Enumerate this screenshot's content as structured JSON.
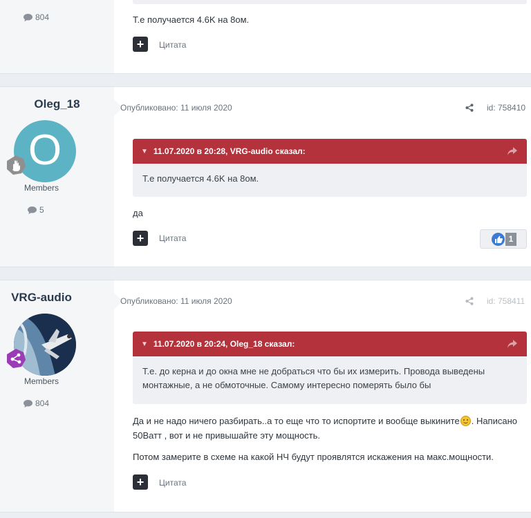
{
  "posts": [
    {
      "count": "804",
      "text": [
        "Т.е получается 4.6K на 8ом."
      ],
      "quote_label": "Цитата"
    },
    {
      "author": "Oleg_18",
      "avatar_letter": "O",
      "role": "Members",
      "count": "5",
      "published": "Опубликовано: 11 июля 2020",
      "post_id": "id: 758410",
      "quote_header": "11.07.2020 в 20:28, VRG-audio сказал:",
      "quote_text": "Т.е получается 4.6K на 8ом.",
      "text": [
        "да"
      ],
      "quote_label": "Цитата",
      "reaction_count": "1"
    },
    {
      "author": "VRG-audio",
      "role": "Members",
      "count": "804",
      "published": "Опубликовано: 11 июля 2020",
      "post_id": "id: 758411",
      "quote_header": "11.07.2020 в 20:24, Oleg_18 сказал:",
      "quote_text": "Т.е. до керна и до окна мне не добраться что бы их измерить. Провода выведены монтажные, а не обмоточные. Самому интересно померять было бы",
      "text": [
        "Да и не надо ничего разбирать..а то еще что то испортите и вообще выкините",
        ". Написано 50Ватт , вот и не привышайте эту мощность.",
        "Потом замерите в схеме на какой НЧ будут проявлятся искажения на макс.мощности."
      ],
      "quote_label": "Цитата"
    }
  ]
}
